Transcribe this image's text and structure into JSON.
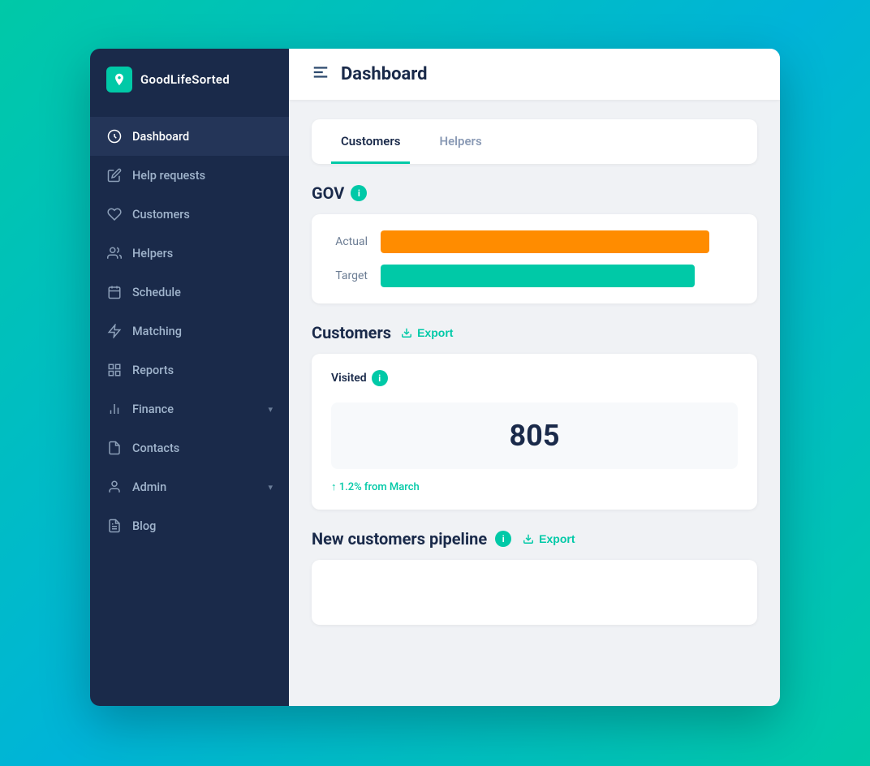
{
  "logo": {
    "text": "GoodLifeSorted"
  },
  "sidebar": {
    "items": [
      {
        "id": "dashboard",
        "label": "Dashboard",
        "icon": "dashboard-icon",
        "active": true,
        "hasChevron": false
      },
      {
        "id": "help-requests",
        "label": "Help requests",
        "icon": "help-icon",
        "active": false,
        "hasChevron": false
      },
      {
        "id": "customers",
        "label": "Customers",
        "icon": "customers-icon",
        "active": false,
        "hasChevron": false
      },
      {
        "id": "helpers",
        "label": "Helpers",
        "icon": "helpers-icon",
        "active": false,
        "hasChevron": false
      },
      {
        "id": "schedule",
        "label": "Schedule",
        "icon": "schedule-icon",
        "active": false,
        "hasChevron": false
      },
      {
        "id": "matching",
        "label": "Matching",
        "icon": "matching-icon",
        "active": false,
        "hasChevron": false
      },
      {
        "id": "reports",
        "label": "Reports",
        "icon": "reports-icon",
        "active": false,
        "hasChevron": false
      },
      {
        "id": "finance",
        "label": "Finance",
        "icon": "finance-icon",
        "active": false,
        "hasChevron": true
      },
      {
        "id": "contacts",
        "label": "Contacts",
        "icon": "contacts-icon",
        "active": false,
        "hasChevron": false
      },
      {
        "id": "admin",
        "label": "Admin",
        "icon": "admin-icon",
        "active": false,
        "hasChevron": true
      },
      {
        "id": "blog",
        "label": "Blog",
        "icon": "blog-icon",
        "active": false,
        "hasChevron": false
      }
    ]
  },
  "topbar": {
    "title": "Dashboard",
    "menu_icon": "≡"
  },
  "tabs": [
    {
      "id": "customers",
      "label": "Customers",
      "active": true
    },
    {
      "id": "helpers",
      "label": "Helpers",
      "active": false
    }
  ],
  "gov_section": {
    "title": "GOV",
    "info": "i",
    "actual_label": "Actual",
    "target_label": "Target",
    "actual_percent": 92,
    "target_percent": 88
  },
  "customers_section": {
    "title": "Customers",
    "export_label": "Export",
    "metrics": [
      {
        "label": "Visited",
        "info": "i",
        "value": "805",
        "change": "↑ 1.2% from March"
      }
    ]
  },
  "pipeline_section": {
    "title": "New customers pipeline",
    "info": "i",
    "export_label": "Export"
  }
}
